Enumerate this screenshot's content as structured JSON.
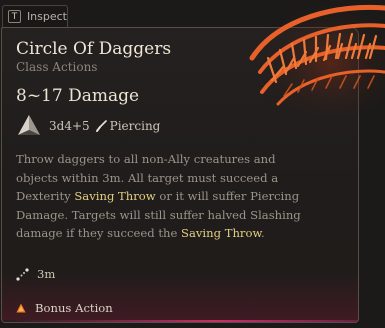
{
  "inspect_tab": {
    "key": "T",
    "label": "Inspect"
  },
  "spell": {
    "name": "Circle Of Daggers",
    "category": "Class Actions",
    "damage": "8~17 Damage",
    "dice": "3d4+5",
    "damage_type": "Piercing",
    "description": {
      "part1": "Throw daggers to all non-Ally creatures and objects within 3m. All target  must succeed a Dexterity ",
      "keyword1": "Saving Throw",
      "part2": " or it will suffer Piercing Damage. Targets will still suffer halved Slashing damage if they succeed the ",
      "keyword2": "Saving Throw",
      "part3": "."
    },
    "range": "3m",
    "action_cost": "Bonus Action"
  },
  "colors": {
    "highlight": "#e2cf83",
    "accent_glow": "#c8306a",
    "art_orange": "#e8612a",
    "bonus_action_icon": "#f07a1e"
  },
  "icons": {
    "dice": "d4-die-icon",
    "damage_type": "dagger-icon",
    "range": "range-line-icon",
    "action": "triangle-bonus-action-icon"
  }
}
